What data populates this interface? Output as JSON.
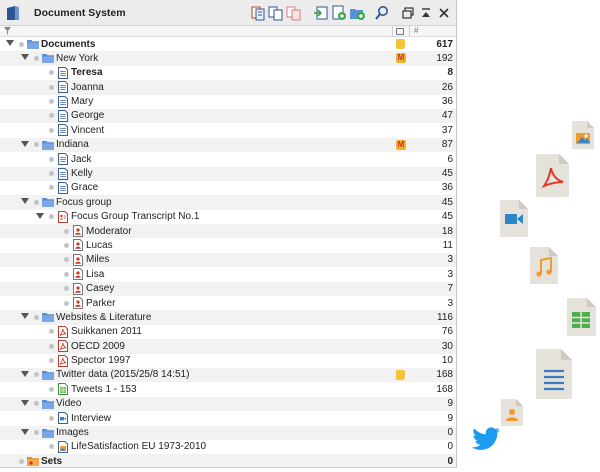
{
  "window": {
    "title": "Document System"
  },
  "header_columns": {
    "hash": "#"
  },
  "memo_badge_letter": "M",
  "colors": {
    "folder": "#5b8fd6",
    "doc": "#3b5f9e",
    "pdf": "#c23b2b",
    "person": "#c23b2b",
    "memo_yellow": "#f5c33b",
    "sets_orange": "#f08a24"
  },
  "tree": [
    {
      "label": "Documents",
      "count": "617",
      "depth": 0,
      "icon": "folder-icon",
      "bold": true,
      "expanded": true,
      "memo": "yellow"
    },
    {
      "label": "New York",
      "count": "192",
      "depth": 1,
      "icon": "folder-icon",
      "expanded": true,
      "memo": "m"
    },
    {
      "label": "Teresa",
      "count": "8",
      "depth": 2,
      "icon": "text-doc-icon",
      "bold": true
    },
    {
      "label": "Joanna",
      "count": "26",
      "depth": 2,
      "icon": "text-doc-icon"
    },
    {
      "label": "Mary",
      "count": "36",
      "depth": 2,
      "icon": "text-doc-icon"
    },
    {
      "label": "George",
      "count": "47",
      "depth": 2,
      "icon": "text-doc-icon"
    },
    {
      "label": "Vincent",
      "count": "37",
      "depth": 2,
      "icon": "text-doc-icon"
    },
    {
      "label": "Indiana",
      "count": "87",
      "depth": 1,
      "icon": "folder-icon",
      "expanded": true,
      "memo": "m"
    },
    {
      "label": "Jack",
      "count": "6",
      "depth": 2,
      "icon": "text-doc-icon"
    },
    {
      "label": "Kelly",
      "count": "45",
      "depth": 2,
      "icon": "text-doc-icon"
    },
    {
      "label": "Grace",
      "count": "36",
      "depth": 2,
      "icon": "text-doc-icon"
    },
    {
      "label": "Focus group",
      "count": "45",
      "depth": 1,
      "icon": "folder-icon",
      "expanded": true
    },
    {
      "label": "Focus Group Transcript No.1",
      "count": "45",
      "depth": 2,
      "icon": "focus-group-doc-icon",
      "expanded": true
    },
    {
      "label": "Moderator",
      "count": "18",
      "depth": 3,
      "icon": "speaker-icon"
    },
    {
      "label": "Lucas",
      "count": "11",
      "depth": 3,
      "icon": "speaker-icon"
    },
    {
      "label": "Miles",
      "count": "3",
      "depth": 3,
      "icon": "speaker-icon"
    },
    {
      "label": "Lisa",
      "count": "3",
      "depth": 3,
      "icon": "speaker-icon"
    },
    {
      "label": "Casey",
      "count": "7",
      "depth": 3,
      "icon": "speaker-icon"
    },
    {
      "label": "Parker",
      "count": "3",
      "depth": 3,
      "icon": "speaker-icon"
    },
    {
      "label": "Websites & Literature",
      "count": "116",
      "depth": 1,
      "icon": "folder-icon",
      "expanded": true
    },
    {
      "label": "Suikkanen 2011",
      "count": "76",
      "depth": 2,
      "icon": "pdf-doc-icon"
    },
    {
      "label": "OECD 2009",
      "count": "30",
      "depth": 2,
      "icon": "pdf-doc-icon"
    },
    {
      "label": "Spector 1997",
      "count": "10",
      "depth": 2,
      "icon": "pdf-doc-icon"
    },
    {
      "label": "Twitter data (2015/25/8 14:51)",
      "count": "168",
      "depth": 1,
      "icon": "folder-icon",
      "expanded": true,
      "memo": "yellow"
    },
    {
      "label": "Tweets 1 - 153",
      "count": "168",
      "depth": 2,
      "icon": "table-doc-icon"
    },
    {
      "label": "Video",
      "count": "9",
      "depth": 1,
      "icon": "folder-icon",
      "expanded": true
    },
    {
      "label": "Interview",
      "count": "9",
      "depth": 2,
      "icon": "video-doc-icon"
    },
    {
      "label": "Images",
      "count": "0",
      "depth": 1,
      "icon": "folder-icon",
      "expanded": true
    },
    {
      "label": "LifeSatisfaction EU 1973-2010",
      "count": "0",
      "depth": 2,
      "icon": "image-doc-icon"
    },
    {
      "label": "Sets",
      "count": "0",
      "depth": 0,
      "icon": "sets-folder-icon",
      "bold": true
    }
  ]
}
